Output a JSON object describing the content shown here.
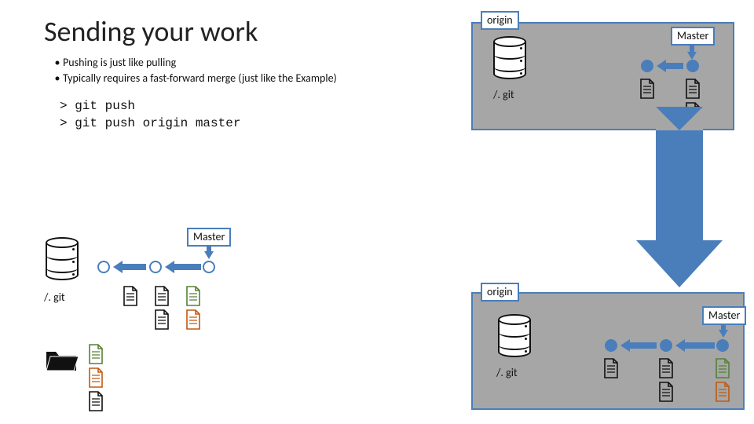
{
  "title": "Sending your work",
  "bullets": [
    "Pushing is just like pulling",
    "Typically requires a fast-forward merge (just like the Example)"
  ],
  "code_lines": [
    "> git push",
    "> git push origin master"
  ],
  "labels": {
    "origin": "origin",
    "master": "Master",
    "gitdir": "/. git"
  },
  "colors": {
    "accent": "#4a7ebb",
    "panel": "#a6a6a6",
    "doc_orange": "#c05a11",
    "doc_green": "#548235",
    "doc_black": "#111"
  }
}
